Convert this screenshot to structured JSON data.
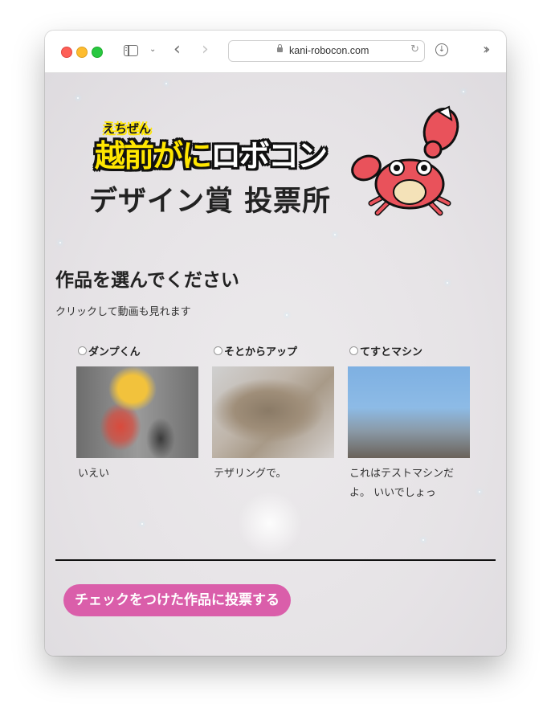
{
  "browser": {
    "url": "kani-robocon.com"
  },
  "header": {
    "logo_ruby": "えちぜん",
    "logo_part1": "越前がに",
    "logo_part2": "ロボコン",
    "subtitle": "デザイン賞 投票所"
  },
  "main": {
    "heading": "作品を選んでください",
    "hint": "クリックして動画も見れます",
    "items": [
      {
        "name": "ダンプくん",
        "description": "いえい"
      },
      {
        "name": "そとからアップ",
        "description": "テザリングで。"
      },
      {
        "name": "てすとマシン",
        "description": "これはテストマシンだよ。 いいでしょっ"
      }
    ]
  },
  "footer": {
    "vote_button": "チェックをつけた作品に投票する"
  },
  "colors": {
    "accent": "#da5eaa",
    "logo_yellow": "#ffe600"
  }
}
